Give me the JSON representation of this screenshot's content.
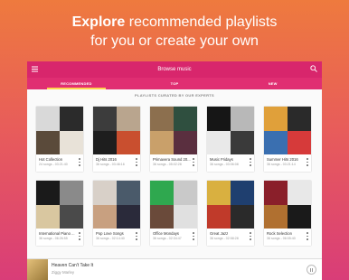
{
  "promo": {
    "bold": "Explore",
    "rest_line1": "recommended playlists",
    "line2": "for you or create your own"
  },
  "appbar": {
    "title": "Browse music",
    "menu_icon": "hamburger-menu-icon",
    "search_icon": "search-icon"
  },
  "tabs": [
    {
      "label": "RECOMMENDED",
      "active": true
    },
    {
      "label": "TOP",
      "active": false
    },
    {
      "label": "NEW",
      "active": false
    }
  ],
  "section_title": "PLAYLISTS CURATED BY OUR EXPERTS",
  "playlists": [
    {
      "name": "Hot Collection",
      "meta": "24 songs - 03:21:40",
      "colors": [
        "#d9d9d9",
        "#2b2b2b",
        "#5a4a3a",
        "#e8e2d8"
      ]
    },
    {
      "name": "Dj Hits 2016",
      "meta": "36 songs - 03:46:16",
      "colors": [
        "#3c3c3c",
        "#b9a58e",
        "#1e1e1e",
        "#c94f2f"
      ]
    },
    {
      "name": "Primavera Sound 20...",
      "meta": "36 songs - 05:02:28",
      "colors": [
        "#8c6f4e",
        "#2f4f3f",
        "#c9a06a",
        "#5a2f3f"
      ]
    },
    {
      "name": "Music Fridays",
      "meta": "36 songs - 03:06:08",
      "colors": [
        "#161616",
        "#b8b8b8",
        "#e9e9e9",
        "#3a3a3a"
      ]
    },
    {
      "name": "Summer Hits 2016",
      "meta": "36 songs - 03:21:14",
      "colors": [
        "#e0a03a",
        "#2a2a2a",
        "#3a6fb0",
        "#d63a3a"
      ]
    },
    {
      "name": "International Piano ...",
      "meta": "36 songs - 06:26:55",
      "colors": [
        "#1a1a1a",
        "#8a8a8a",
        "#d9c7a0",
        "#4a4a4a"
      ]
    },
    {
      "name": "Pop Love Songs",
      "meta": "36 songs - 02:14:40",
      "colors": [
        "#d8d0c8",
        "#4a5a6a",
        "#c8a080",
        "#2a2a3a"
      ]
    },
    {
      "name": "Office Mondays",
      "meta": "36 songs - 02:34:47",
      "colors": [
        "#2fa84f",
        "#c9c9c9",
        "#6a4a3a",
        "#e0e0e0"
      ]
    },
    {
      "name": "Great Jazz",
      "meta": "36 songs - 02:58:28",
      "colors": [
        "#d9b040",
        "#1f3f6f",
        "#c03a2a",
        "#2a2a2a"
      ]
    },
    {
      "name": "Rock Selection",
      "meta": "36 songs - 06:05:40",
      "colors": [
        "#8a1f2a",
        "#e8e8e8",
        "#b07030",
        "#1a1a1a"
      ]
    }
  ],
  "player": {
    "track": "Heaven Can't Take It",
    "artist": "Ziggy Marley",
    "pause_icon": "pause-icon"
  }
}
